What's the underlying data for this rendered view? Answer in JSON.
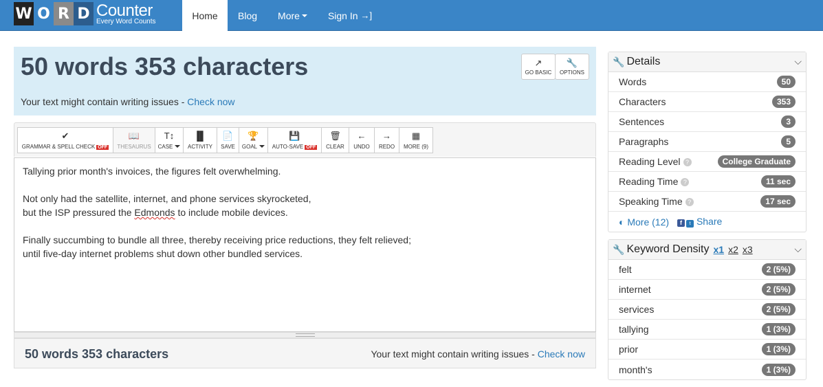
{
  "nav": {
    "logo_letters": [
      "W",
      "O",
      "R",
      "D"
    ],
    "logo_brand": "Counter",
    "logo_tagline": "Every Word Counts",
    "home": "Home",
    "blog": "Blog",
    "more": "More",
    "sign_in": "Sign In"
  },
  "header": {
    "count": "50 words 353 characters",
    "issue_text": "Your text might contain writing issues -",
    "issue_link": "Check now",
    "go_basic": "GO BASIC",
    "options": "OPTIONS"
  },
  "toolbar": {
    "grammar": "GRAMMAR & SPELL CHECK",
    "grammar_state": "OFF",
    "thesaurus": "THESAURUS",
    "case": "CASE",
    "activity": "ACTIVITY",
    "save": "SAVE",
    "goal": "GOAL",
    "autosave": "AUTO-SAVE",
    "autosave_state": "OFF",
    "clear": "CLEAR",
    "undo": "UNDO",
    "redo": "REDO",
    "more": "MORE (9)"
  },
  "editor": {
    "line1": "Tallying prior month's invoices, the figures felt overwhelming.",
    "line2": "Not only had the satellite, internet, and phone services skyrocketed,",
    "line3_a": "but the ISP pressured the ",
    "line3_word": "Edmonds",
    "line3_b": " to include mobile devices.",
    "line4": "Finally succumbing to bundle all three, thereby receiving price reductions, they felt relieved;",
    "line5": "until five-day internet problems shut down other bundled services."
  },
  "footer": {
    "count": "50 words 353 characters",
    "issue_text": "Your text might contain writing issues -",
    "issue_link": "Check now"
  },
  "details": {
    "title": "Details",
    "rows": [
      {
        "label": "Words",
        "value": "50"
      },
      {
        "label": "Characters",
        "value": "353"
      },
      {
        "label": "Sentences",
        "value": "3"
      },
      {
        "label": "Paragraphs",
        "value": "5"
      },
      {
        "label": "Reading Level",
        "value": "College Graduate"
      },
      {
        "label": "Reading Time",
        "value": "11 sec"
      },
      {
        "label": "Speaking Time",
        "value": "17 sec"
      }
    ],
    "more": "More (12)",
    "share": "Share"
  },
  "keyword": {
    "title": "Keyword Density",
    "x1": "x1",
    "x2": "x2",
    "x3": "x3",
    "rows": [
      {
        "word": "felt",
        "value": "2 (5%)"
      },
      {
        "word": "internet",
        "value": "2 (5%)"
      },
      {
        "word": "services",
        "value": "2 (5%)"
      },
      {
        "word": "tallying",
        "value": "1 (3%)"
      },
      {
        "word": "prior",
        "value": "1 (3%)"
      },
      {
        "word": "month's",
        "value": "1 (3%)"
      }
    ]
  }
}
